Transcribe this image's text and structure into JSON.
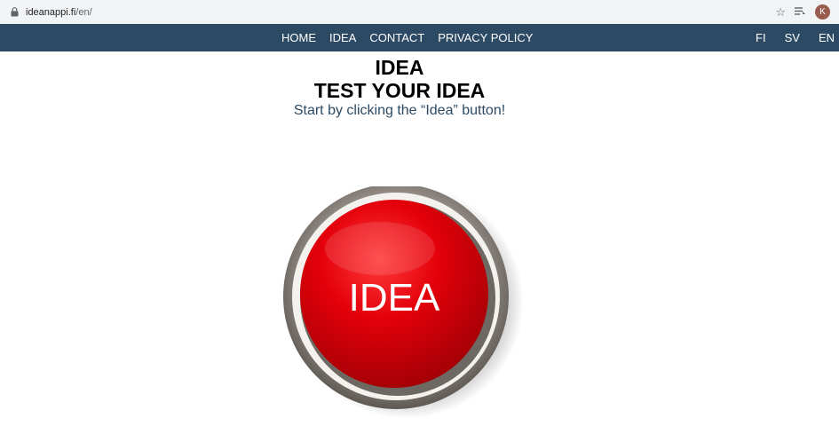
{
  "browser": {
    "url_host": "ideanappi.fi",
    "url_path": "/en/",
    "avatar_letter": "K"
  },
  "nav": {
    "links": [
      "HOME",
      "IDEA",
      "CONTACT",
      "PRIVACY POLICY"
    ],
    "languages": [
      "FI",
      "SV",
      "EN"
    ]
  },
  "page": {
    "title": "IDEA",
    "subtitle": "TEST YOUR IDEA",
    "hint": "Start by clicking the “Idea” button!"
  },
  "idea_button": {
    "label": "IDEA"
  },
  "colors": {
    "nav_background": "#2c4a63",
    "button_red": "#e3000a",
    "button_ring": "#8a837c"
  }
}
